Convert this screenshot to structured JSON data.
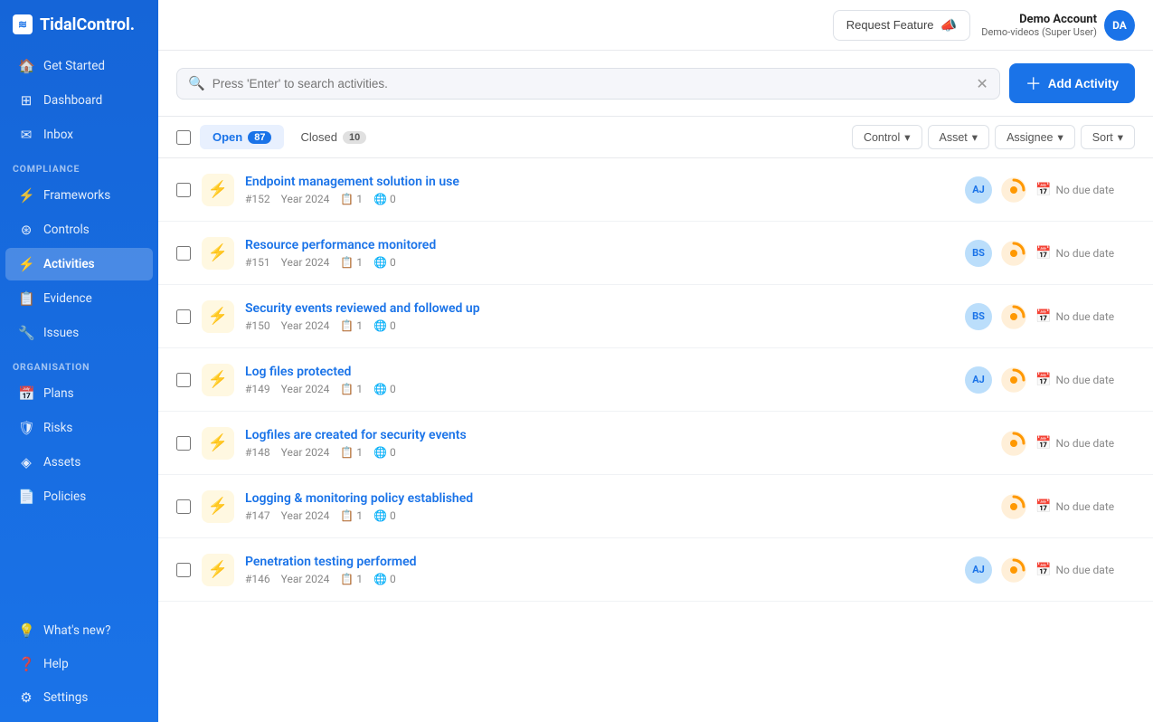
{
  "app": {
    "name": "TidalControl",
    "logo_text": "TidalControl."
  },
  "topbar": {
    "request_feature_label": "Request Feature",
    "user_name": "Demo Account",
    "user_sub": "Demo-videos (Super User)",
    "user_initials": "DA",
    "user_avatar_color": "#1a73e8"
  },
  "search": {
    "placeholder": "Press 'Enter' to search activities.",
    "add_button_label": "Add Activity"
  },
  "tabs": [
    {
      "label": "Open",
      "count": "87",
      "active": true
    },
    {
      "label": "Closed",
      "count": "10",
      "active": false
    }
  ],
  "filters": [
    {
      "label": "Control"
    },
    {
      "label": "Asset"
    },
    {
      "label": "Assignee"
    },
    {
      "label": "Sort"
    }
  ],
  "sidebar": {
    "sections": [
      {
        "items": [
          {
            "label": "Get Started",
            "icon": "🏠"
          },
          {
            "label": "Dashboard",
            "icon": "📊"
          },
          {
            "label": "Inbox",
            "icon": "📥"
          }
        ]
      },
      {
        "section_label": "COMPLIANCE",
        "items": [
          {
            "label": "Frameworks",
            "icon": "⚡"
          },
          {
            "label": "Controls",
            "icon": "🛡"
          },
          {
            "label": "Activities",
            "icon": "⚡",
            "active": true
          },
          {
            "label": "Evidence",
            "icon": "📋"
          },
          {
            "label": "Issues",
            "icon": "🔧"
          }
        ]
      },
      {
        "section_label": "ORGANISATION",
        "items": [
          {
            "label": "Plans",
            "icon": "📅"
          },
          {
            "label": "Risks",
            "icon": "🛡"
          },
          {
            "label": "Assets",
            "icon": "💎"
          },
          {
            "label": "Policies",
            "icon": "📄"
          }
        ]
      }
    ],
    "bottom_items": [
      {
        "label": "What's new?",
        "icon": "💡"
      },
      {
        "label": "Help",
        "icon": "❓"
      },
      {
        "label": "Settings",
        "icon": "⚙"
      }
    ]
  },
  "activities": [
    {
      "id": "#152",
      "title": "Endpoint management solution in use",
      "period": "Year 2024",
      "tasks": "1",
      "links": "0",
      "assignees": [
        "AJ"
      ],
      "has_status": true,
      "due_date": "No due date"
    },
    {
      "id": "#151",
      "title": "Resource performance monitored",
      "period": "Year 2024",
      "tasks": "1",
      "links": "0",
      "assignees": [
        "BS"
      ],
      "has_status": true,
      "due_date": "No due date"
    },
    {
      "id": "#150",
      "title": "Security events reviewed and followed up",
      "period": "Year 2024",
      "tasks": "1",
      "links": "0",
      "assignees": [
        "BS"
      ],
      "has_status": true,
      "due_date": "No due date"
    },
    {
      "id": "#149",
      "title": "Log files protected",
      "period": "Year 2024",
      "tasks": "1",
      "links": "0",
      "assignees": [
        "AJ"
      ],
      "has_status": true,
      "due_date": "No due date"
    },
    {
      "id": "#148",
      "title": "Logfiles are created for security events",
      "period": "Year 2024",
      "tasks": "1",
      "links": "0",
      "assignees": [],
      "has_status": true,
      "due_date": "No due date"
    },
    {
      "id": "#147",
      "title": "Logging & monitoring policy established",
      "period": "Year 2024",
      "tasks": "1",
      "links": "0",
      "assignees": [],
      "has_status": true,
      "due_date": "No due date"
    },
    {
      "id": "#146",
      "title": "Penetration testing performed",
      "period": "Year 2024",
      "tasks": "1",
      "links": "0",
      "assignees": [
        "AJ"
      ],
      "has_status": true,
      "due_date": "No due date"
    }
  ]
}
